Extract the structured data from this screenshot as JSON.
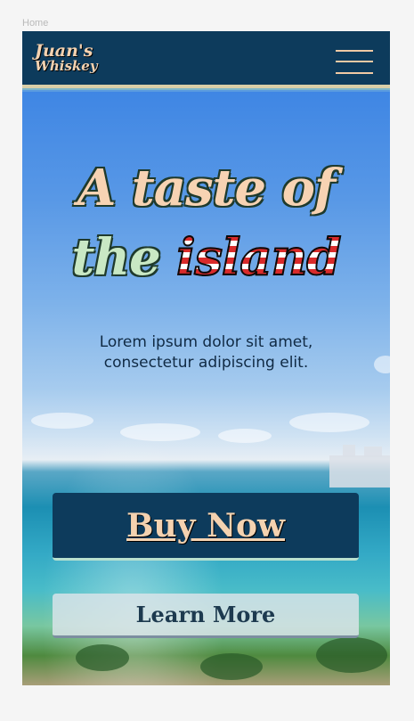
{
  "breadcrumb": {
    "label": "Home"
  },
  "header": {
    "logo_line1": "Juan's",
    "logo_line2": "Whiskey",
    "menu_icon": "hamburger-menu-icon"
  },
  "hero": {
    "title_part1": "A taste of",
    "title_part2": "the",
    "title_highlight": "island",
    "subtitle": "Lorem ipsum dolor sit amet, consectetur adipiscing elit."
  },
  "buttons": {
    "buy_label": "Buy Now",
    "learn_label": "Learn More"
  },
  "colors": {
    "navy": "#0d3b5c",
    "peach": "#f4d2b0",
    "mint": "#c9e8c4",
    "flag_red": "#d92b2b"
  }
}
